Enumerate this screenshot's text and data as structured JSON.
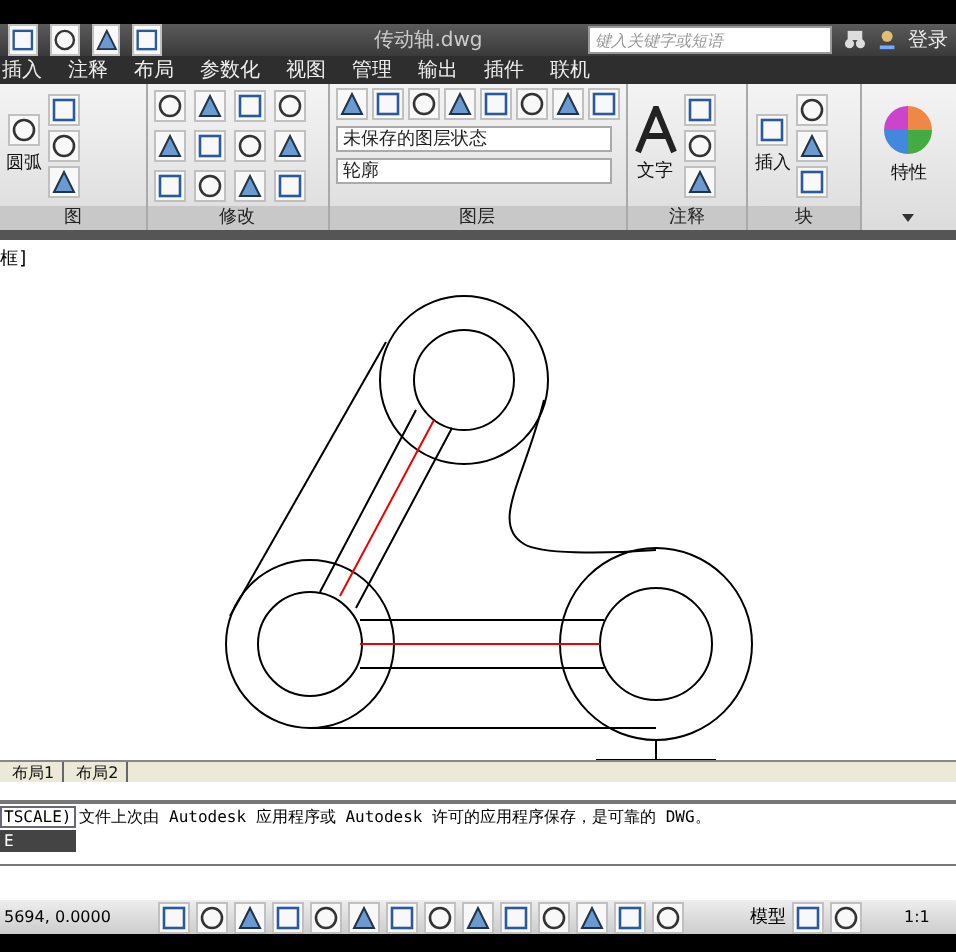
{
  "title_bar": {
    "title": "传动轴.dwg",
    "search": {
      "placeholder": "键入关键字或短语"
    },
    "login": "登录"
  },
  "tabs": [
    {
      "label": "插入"
    },
    {
      "label": "注释"
    },
    {
      "label": "布局"
    },
    {
      "label": "参数化"
    },
    {
      "label": "视图"
    },
    {
      "label": "管理"
    },
    {
      "label": "输出"
    },
    {
      "label": "插件"
    },
    {
      "label": "联机"
    }
  ],
  "ribbon": {
    "draw": {
      "arc_label": "圆弧",
      "title": "图"
    },
    "modify": {
      "title": "修改"
    },
    "layers": {
      "layer_state": "未保存的图层状态",
      "current_layer": "轮廓",
      "title": "图层"
    },
    "annotate": {
      "text_label": "文字",
      "title": "注释"
    },
    "block": {
      "insert_label": "插入",
      "title": "块"
    },
    "properties": {
      "label": "特性"
    }
  },
  "viewport_label": "框]",
  "layout_tabs": [
    {
      "label": "布局1"
    },
    {
      "label": "布局2"
    }
  ],
  "command": {
    "history_tag": "TSCALE)",
    "message": "文件上次由 Autodesk 应用程序或 Autodesk 许可的应用程序保存，是可靠的 DWG。",
    "input": "E"
  },
  "status_bar": {
    "coordinates": "5694, 0.0000",
    "model": "模型",
    "scale": "1:1"
  }
}
